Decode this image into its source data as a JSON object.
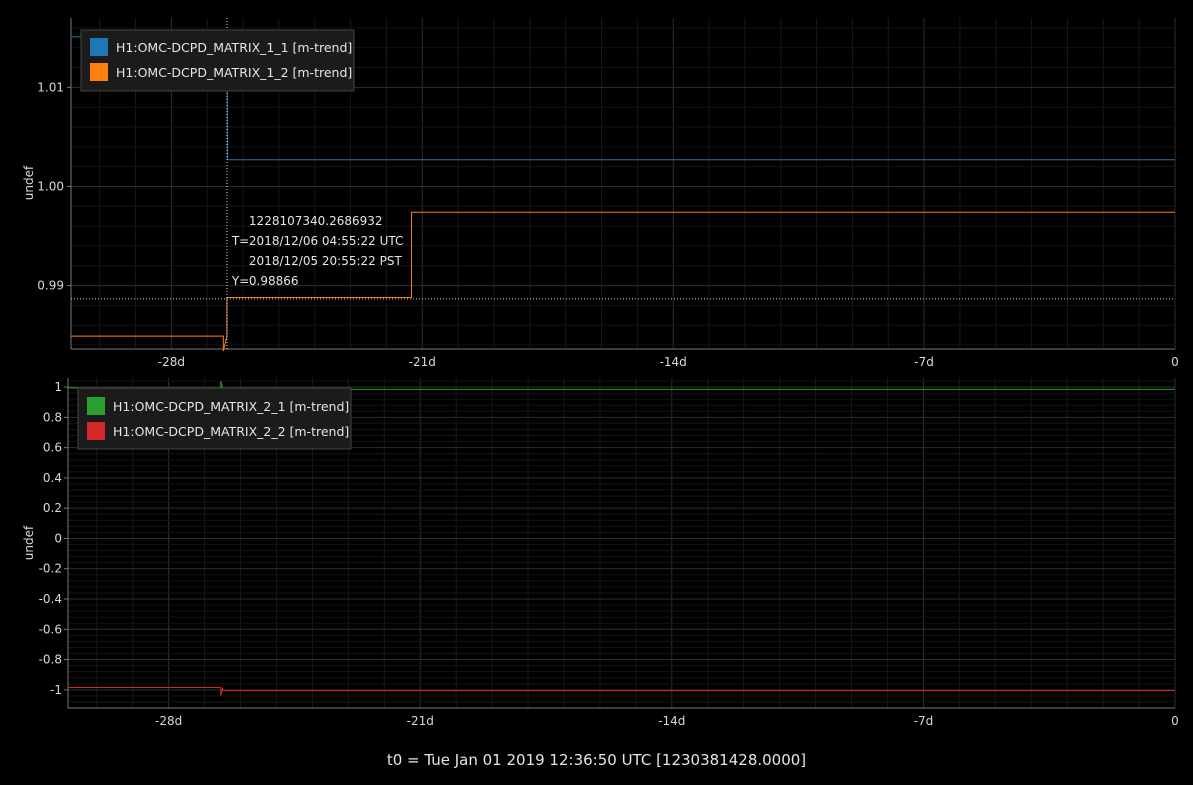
{
  "footer": "t0 = Tue Jan 01 2019 12:36:50 UTC [1230381428.0000]",
  "chart_data": [
    {
      "type": "line",
      "ylabel": "undef",
      "x_unit": "days relative to t0",
      "xlim": [
        -30.8,
        0
      ],
      "ylim": [
        0.9836,
        1.017
      ],
      "x_ticks": [
        -28,
        -21,
        -14,
        -7,
        0
      ],
      "x_tick_labels": [
        "-28d",
        "-21d",
        "-14d",
        "-7d",
        "0"
      ],
      "y_ticks": [
        0.99,
        1.0,
        1.01
      ],
      "y_tick_labels": [
        "0.99",
        "1.00",
        "1.01"
      ],
      "grid": true,
      "legend_position": "top-left",
      "series": [
        {
          "name": "H1:OMC-DCPD_MATRIX_1_1 [m-trend]",
          "color": "#1f77b4",
          "x": [
            -30.8,
            -26.45,
            -26.43,
            0
          ],
          "y": [
            1.0151,
            1.0151,
            1.0027,
            1.0027
          ]
        },
        {
          "name": "H1:OMC-DCPD_MATRIX_1_2 [m-trend]",
          "color": "#ff7f0e",
          "x": [
            -30.8,
            -26.55,
            -26.55,
            -26.45,
            -26.45,
            -21.3,
            -21.3,
            0
          ],
          "y": [
            0.9849,
            0.9849,
            0.9834,
            0.9849,
            0.9888,
            0.9888,
            0.9974,
            0.9974
          ]
        }
      ],
      "cursor": {
        "x": -26.45,
        "y": 0.98866,
        "gps": "1228107340.2686932",
        "t_prefix": "T=",
        "utc": "2018/12/06 04:55:22 UTC",
        "pst": "2018/12/05 20:55:22 PST",
        "y_prefix": "Y=",
        "y_text": "0.98866"
      }
    },
    {
      "type": "line",
      "ylabel": "undef",
      "x_unit": "days relative to t0",
      "xlim": [
        -30.8,
        0
      ],
      "ylim": [
        -1.12,
        1.06
      ],
      "x_ticks": [
        -28,
        -21,
        -14,
        -7,
        0
      ],
      "x_tick_labels": [
        "-28d",
        "-21d",
        "-14d",
        "-7d",
        "0"
      ],
      "y_ticks": [
        1,
        0.8,
        0.6,
        0.4,
        0.2,
        0,
        -0.2,
        -0.4,
        -0.6,
        -0.8,
        -1
      ],
      "y_tick_labels": [
        "1",
        "0.8",
        "0.6",
        "0.4",
        "0.2",
        "0",
        "-0.2",
        "-0.4",
        "-0.6",
        "-0.8",
        "-1"
      ],
      "grid": true,
      "legend_position": "top-left",
      "series": [
        {
          "name": "H1:OMC-DCPD_MATRIX_2_1 [m-trend]",
          "color": "#2ca02c",
          "x": [
            -30.8,
            -26.55,
            -26.55,
            -26.5,
            -26.5,
            0
          ],
          "y": [
            0.995,
            0.995,
            1.04,
            0.995,
            0.985,
            0.985
          ]
        },
        {
          "name": "H1:OMC-DCPD_MATRIX_2_2 [m-trend]",
          "color": "#d62728",
          "x": [
            -30.8,
            -26.55,
            -26.55,
            -26.5,
            -26.5,
            0
          ],
          "y": [
            -0.985,
            -0.985,
            -1.04,
            -0.985,
            -1.005,
            -1.005
          ]
        }
      ]
    }
  ]
}
